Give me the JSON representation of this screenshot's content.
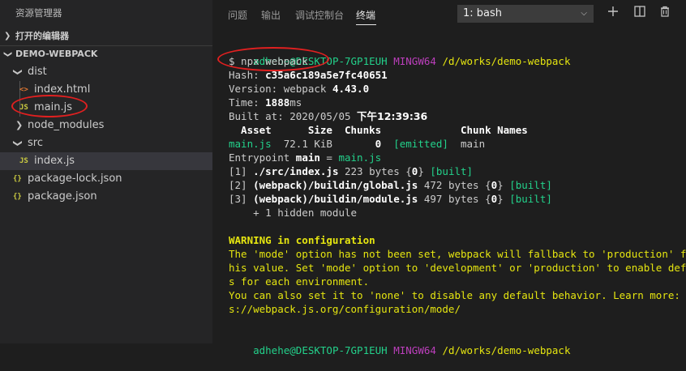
{
  "explorer": {
    "title": "资源管理器",
    "open_editors": "打开的编辑器",
    "project": "DEMO-WEBPACK",
    "items": [
      {
        "label": "dist",
        "kind": "folder-open"
      },
      {
        "label": "index.html",
        "kind": "html"
      },
      {
        "label": "main.js",
        "kind": "js"
      },
      {
        "label": "node_modules",
        "kind": "folder"
      },
      {
        "label": "src",
        "kind": "folder-open"
      },
      {
        "label": "index.js",
        "kind": "js"
      },
      {
        "label": "package-lock.json",
        "kind": "json"
      },
      {
        "label": "package.json",
        "kind": "json"
      }
    ],
    "icon_glyphs": {
      "html": "<>",
      "js": "JS",
      "json": "{}"
    }
  },
  "panel": {
    "tabs": [
      "问题",
      "输出",
      "调试控制台",
      "终端"
    ],
    "active_tab": "终端",
    "terminal_select": "1: bash"
  },
  "terminal": {
    "prompt_user": "adhehe@DESKTOP-7GP1EUH",
    "prompt_env": "MINGW64",
    "prompt_path": "/d/works/demo-webpack",
    "command": "$ npx webpack",
    "hash_label": "Hash: ",
    "hash_value": "c35a6c189a5e7fc40651",
    "version_label": "Version: webpack ",
    "version_value": "4.43.0",
    "time_label": "Time: ",
    "time_value": "1888",
    "time_unit": "ms",
    "built_label": "Built at: 2020/05/05 ",
    "built_value": "下午12:39:36",
    "table_header": "  Asset      Size  Chunks             Chunk Names",
    "asset_name": "main.js",
    "asset_size": "  72.1 KiB       ",
    "asset_chunk": "0",
    "asset_emitted": "[emitted]",
    "asset_chunkname": "main",
    "entry_label": "Entrypoint ",
    "entry_main": "main",
    "entry_eq": " = ",
    "entry_file": "main.js",
    "modules": [
      {
        "id": "[1] ",
        "path": "./src/index.js",
        "size": " 223 bytes {",
        "chunk": "0",
        "end": "} ",
        "tag": "[built]"
      },
      {
        "id": "[2] ",
        "path": "(webpack)/buildin/global.js",
        "size": " 472 bytes {",
        "chunk": "0",
        "end": "} ",
        "tag": "[built]"
      },
      {
        "id": "[3] ",
        "path": "(webpack)/buildin/module.js",
        "size": " 497 bytes {",
        "chunk": "0",
        "end": "} ",
        "tag": "[built]"
      }
    ],
    "hidden": "    + 1 hidden module",
    "warning_lines": [
      "WARNING in configuration",
      "The 'mode' option has not been set, webpack will fallback to 'production' for t",
      "his value. Set 'mode' option to 'development' or 'production' to enable default",
      "s for each environment.",
      "You can also set it to 'none' to disable any default behavior. Learn more: http",
      "s://webpack.js.org/configuration/mode/"
    ]
  },
  "colors": {
    "annotation": "#e02020",
    "accent_green": "#23d18b",
    "accent_yellow": "#e5e510",
    "accent_magenta": "#bc3fbc"
  }
}
